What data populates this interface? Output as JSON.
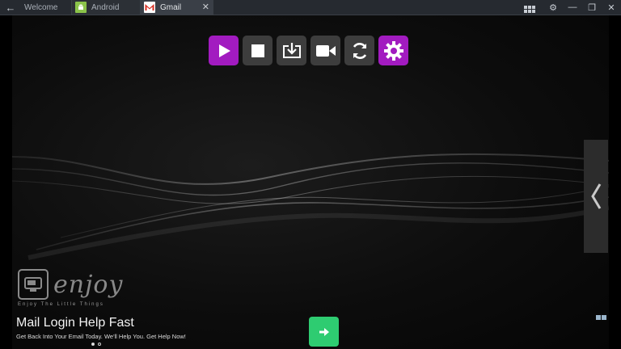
{
  "titlebar": {
    "tabs": [
      {
        "label": "Welcome"
      },
      {
        "label": "Android"
      },
      {
        "label": "Gmail"
      }
    ]
  },
  "toolbar": {
    "buttons": [
      {
        "name": "play",
        "icon": "play-icon"
      },
      {
        "name": "stop",
        "icon": "stop-icon"
      },
      {
        "name": "download",
        "icon": "download-icon"
      },
      {
        "name": "record",
        "icon": "video-camera-icon"
      },
      {
        "name": "refresh",
        "icon": "refresh-icon"
      },
      {
        "name": "settings",
        "icon": "gear-icon"
      }
    ]
  },
  "logo": {
    "word": "enjoy",
    "tagline": "Enjoy The Little Things"
  },
  "promo": {
    "headline": "Mail Login Help Fast",
    "subline": "Get Back Into Your Email Today. We'll Help You. Get Help Now!"
  },
  "colors": {
    "accent_purple": "#a21bc0",
    "next_green": "#2ecc71",
    "titlebar": "#262a30"
  }
}
